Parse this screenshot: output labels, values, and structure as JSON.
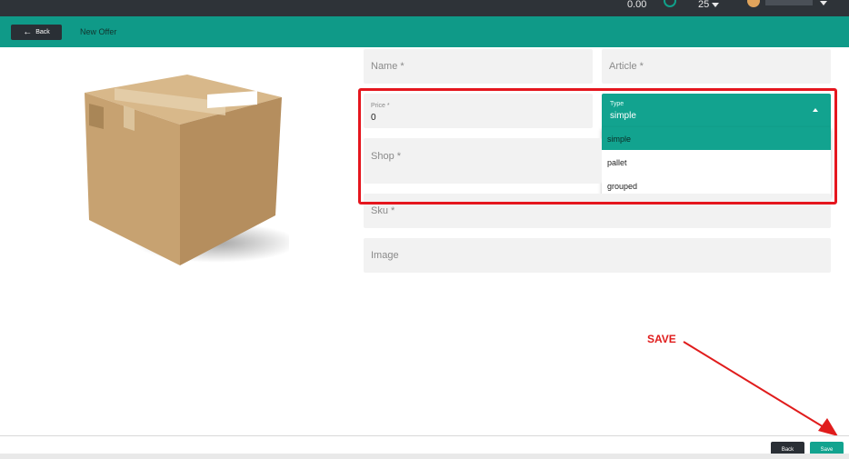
{
  "topbar": {
    "balance": "0.00",
    "count": "25",
    "user_name": ""
  },
  "subbar": {
    "back_label": "Back",
    "page_title": "New Offer"
  },
  "form": {
    "name_placeholder": "Name *",
    "article_placeholder": "Article *",
    "price_label": "Price *",
    "price_value": "0",
    "shop_placeholder": "Shop *",
    "sku_placeholder": "Sku *",
    "image_placeholder": "Image",
    "type": {
      "label": "Type",
      "value": "simple",
      "options": [
        "simple",
        "pallet",
        "grouped"
      ]
    }
  },
  "annotation": {
    "text": "SAVE"
  },
  "footer": {
    "back_label": "Back",
    "save_label": "Save"
  },
  "colors": {
    "topbar": "#2e3338",
    "teal": "#0f9a88",
    "highlight": "#e5161e",
    "field": "#f2f2f2"
  }
}
